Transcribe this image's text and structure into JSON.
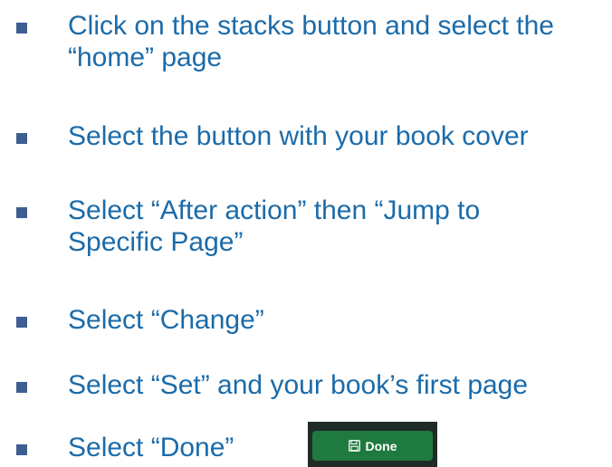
{
  "instructions": [
    {
      "line1": "Click on the stacks button and select the",
      "line2": "“home” page"
    },
    {
      "line1": "Select the button with your book cover",
      "line2": ""
    },
    {
      "line1": "Select “After action” then “Jump to",
      "line2": "Specific Page”"
    },
    {
      "line1": "Select “Change”",
      "line2": ""
    },
    {
      "line1": "Select “Set” and your book’s first page",
      "line2": ""
    },
    {
      "line1": "Select “Done”",
      "line2": ""
    }
  ],
  "done_button": {
    "label": "Done",
    "icon": "save-icon"
  },
  "colors": {
    "text": "#1b6ba9",
    "bullet": "#3e5e92",
    "button_bg": "#1f7a3f",
    "button_frame": "#1f2b27"
  }
}
